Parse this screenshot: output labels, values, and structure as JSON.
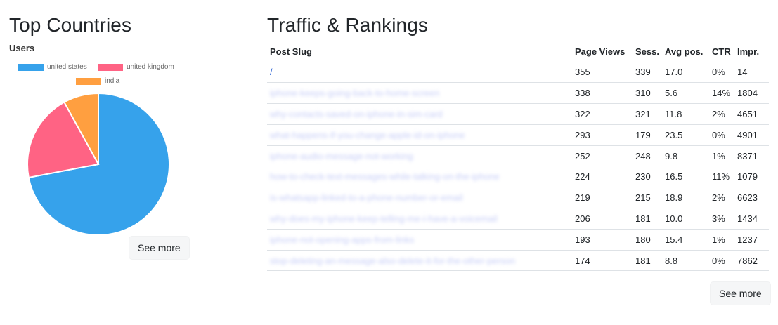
{
  "top_countries": {
    "title": "Top Countries",
    "see_more": "See more",
    "chart_data": {
      "type": "pie",
      "title": "Users",
      "legend_position": "top",
      "categories": [
        "united states",
        "united kingdom",
        "india"
      ],
      "values": [
        72,
        20,
        8
      ],
      "colors": [
        "#36a2eb",
        "#ff6384",
        "#ff9f40"
      ]
    }
  },
  "traffic": {
    "title": "Traffic & Rankings",
    "see_more": "See more",
    "columns": [
      "Post Slug",
      "Page Views",
      "Sess.",
      "Avg pos.",
      "CTR",
      "Impr."
    ],
    "rows": [
      {
        "slug": "/",
        "blurred": false,
        "page_views": "355",
        "sessions": "339",
        "avg_pos": "17.0",
        "ctr": "0%",
        "impr": "14"
      },
      {
        "slug": "iphone-keeps-going-back-to-home-screen",
        "blurred": true,
        "page_views": "338",
        "sessions": "310",
        "avg_pos": "5.6",
        "ctr": "14%",
        "impr": "1804"
      },
      {
        "slug": "why-contacts-saved-on-iphone-in-sim-card",
        "blurred": true,
        "page_views": "322",
        "sessions": "321",
        "avg_pos": "11.8",
        "ctr": "2%",
        "impr": "4651"
      },
      {
        "slug": "what-happens-if-you-change-apple-id-on-iphone",
        "blurred": true,
        "page_views": "293",
        "sessions": "179",
        "avg_pos": "23.5",
        "ctr": "0%",
        "impr": "4901"
      },
      {
        "slug": "iphone-audio-message-not-working",
        "blurred": true,
        "page_views": "252",
        "sessions": "248",
        "avg_pos": "9.8",
        "ctr": "1%",
        "impr": "8371"
      },
      {
        "slug": "how-to-check-text-messages-while-talking-on-the-iphone",
        "blurred": true,
        "page_views": "224",
        "sessions": "230",
        "avg_pos": "16.5",
        "ctr": "11%",
        "impr": "1079"
      },
      {
        "slug": "is-whatsapp-linked-to-a-phone-number-or-email",
        "blurred": true,
        "page_views": "219",
        "sessions": "215",
        "avg_pos": "18.9",
        "ctr": "2%",
        "impr": "6623"
      },
      {
        "slug": "why-does-my-iphone-keep-telling-me-i-have-a-voicemail",
        "blurred": true,
        "page_views": "206",
        "sessions": "181",
        "avg_pos": "10.0",
        "ctr": "3%",
        "impr": "1434"
      },
      {
        "slug": "iphone-not-opening-apps-from-links",
        "blurred": true,
        "page_views": "193",
        "sessions": "180",
        "avg_pos": "15.4",
        "ctr": "1%",
        "impr": "1237"
      },
      {
        "slug": "stop-deleting-an-message-also-delete-it-for-the-other-person",
        "blurred": true,
        "page_views": "174",
        "sessions": "181",
        "avg_pos": "8.8",
        "ctr": "0%",
        "impr": "7862"
      }
    ]
  }
}
